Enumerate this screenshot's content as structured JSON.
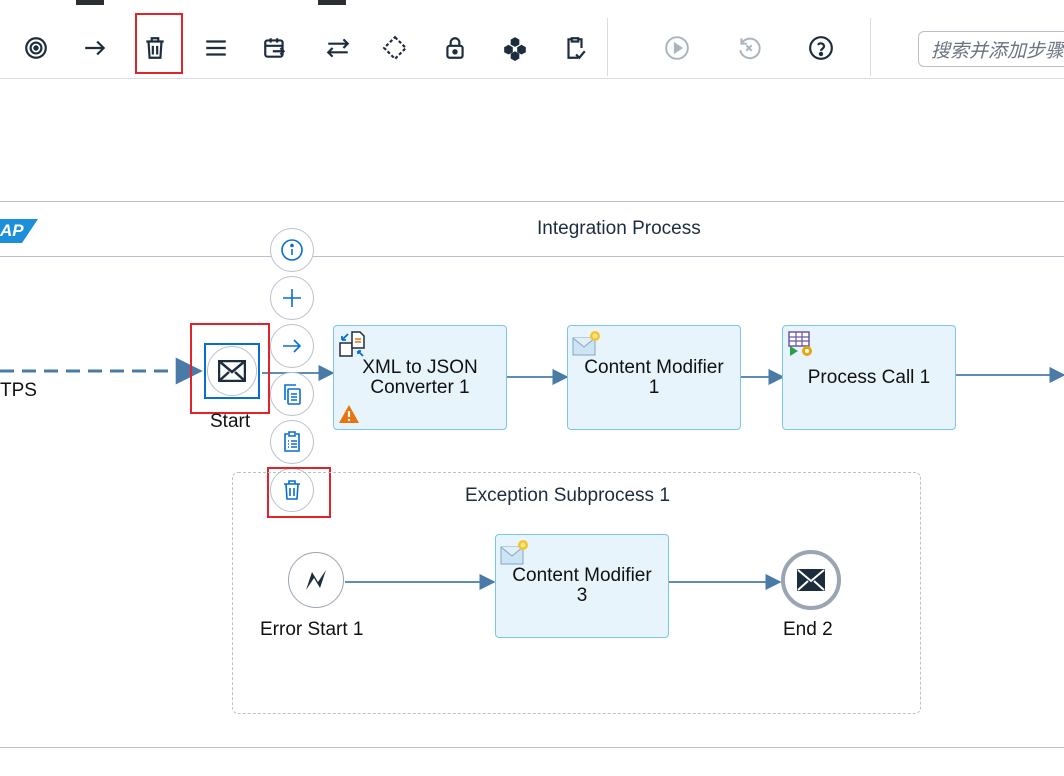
{
  "toolbar": {
    "buttons": [
      {
        "icon": "target-icon"
      },
      {
        "icon": "arrow-right-icon"
      },
      {
        "icon": "trash-icon"
      },
      {
        "icon": "menu-lines-icon"
      },
      {
        "icon": "calendar-arrow-icon"
      },
      {
        "icon": "swap-arrows-icon"
      },
      {
        "icon": "diamond-gateway-icon"
      },
      {
        "icon": "lock-icon"
      },
      {
        "icon": "cube-icon"
      },
      {
        "icon": "clipboard-check-icon"
      },
      {
        "icon": "play-icon"
      },
      {
        "icon": "undo-x-icon"
      },
      {
        "icon": "help-icon"
      }
    ],
    "search_placeholder": "搜索并添加步骤"
  },
  "sender": {
    "label": "TPS"
  },
  "pool": {
    "logo_text": "AP",
    "title": "Integration Process"
  },
  "events": {
    "start": "Start",
    "error_start": "Error Start 1",
    "end": "End 2"
  },
  "steps": {
    "xml_to_json": "XML to JSON\nConverter 1",
    "content_modifier_1": "Content Modifier\n1",
    "process_call_1": "Process Call 1",
    "content_modifier_3": "Content Modifier\n3"
  },
  "subprocess": {
    "title": "Exception Subprocess 1"
  },
  "context_menu": {
    "items": [
      "info-icon",
      "add-icon",
      "connect-arrow-icon",
      "copy-icon",
      "paste-icon",
      "delete-icon"
    ]
  },
  "colors": {
    "accent": "#0a6ed1",
    "highlight_red": "#e0242b",
    "task_fill": "#e8f4fb",
    "task_border": "#7cc6ea",
    "flow_line": "#4a7ba6",
    "warning": "#e9730c"
  }
}
